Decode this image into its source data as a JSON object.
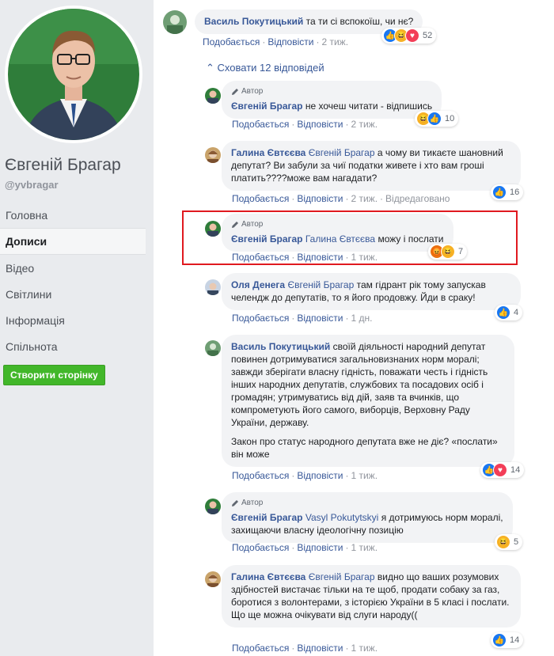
{
  "profile": {
    "name": "Євгеній Брагар",
    "handle": "@yvbragar"
  },
  "nav": {
    "items": [
      "Головна",
      "Дописи",
      "Відео",
      "Світлини",
      "Інформація",
      "Спільнота"
    ],
    "active": "Дописи",
    "create_page": "Створити сторінку"
  },
  "labels": {
    "like": "Подобається",
    "reply": "Відповісти",
    "edited": "Відредаговано",
    "author_badge": "Автор",
    "hide_replies": "Сховати 12 відповідей"
  },
  "comments": [
    {
      "author": "Василь Покутицький",
      "text": "та ти сі вспокоїш, чи нє?",
      "time": "2 тиж.",
      "reactions": [
        "like",
        "haha",
        "love"
      ],
      "count": "52"
    },
    {
      "author": "Євгеній Брагар",
      "text": "не хочеш читати - відпишись",
      "time": "2 тиж.",
      "reactions": [
        "haha",
        "like"
      ],
      "count": "10"
    },
    {
      "author": "Галина Євтєєва",
      "mention": "Євгеній Брагар",
      "text": "а чому ви тикаєте шановний депутат? Ви забули за чиї податки живете і хто вам гроші платить????може вам нагадати?",
      "time": "2 тиж.",
      "reactions": [
        "like"
      ],
      "count": "16"
    },
    {
      "author": "Євгеній Брагар",
      "mention": "Галина Євтєєва",
      "text": "можу і послати",
      "time": "1 тиж.",
      "reactions": [
        "angry",
        "haha"
      ],
      "count": "7"
    },
    {
      "author": "Оля Денега",
      "mention": "Євгеній Брагар",
      "text": "там гідрант рік тому запускав челендж до депутатів, то я його продовжу. Йди в сраку!",
      "time": "1 дн.",
      "reactions": [
        "like"
      ],
      "count": "4"
    },
    {
      "author": "Василь Покутицький",
      "text": "своїй діяльності народний депутат повинен дотримуватися загальновизнаних норм моралі; завжди зберігати власну гідність, поважати честь і гідність інших народних депутатів, службових та посадових осіб і громадян; утримуватись від дій, заяв та вчинків, що компрометують його самого, виборців, Верховну Раду України, державу.",
      "text2": "Закон про статус народного депутата вже не діє? «послати» він може",
      "time": "1 тиж.",
      "reactions": [
        "like",
        "love"
      ],
      "count": "14"
    },
    {
      "author": "Євгеній Брагар",
      "mention": "Vasyl Pokutytskyi",
      "text": "я дотримуюсь норм моралі, захищаючи власну ідеологічну позицію",
      "time": "1 тиж.",
      "reactions": [
        "haha"
      ],
      "count": "5"
    },
    {
      "author": "Галина Євтєєва",
      "mention": "Євгеній Брагар",
      "text": "видно що ваших розумових здібностей вистачає тільки на те щоб, продати собаку за газ, боротися з волонтерами, з історією України в 5 класі і послати. Що ще можна очікувати від слуги народу((",
      "time": "1 тиж.",
      "reactions": [
        "like"
      ],
      "count": "14"
    }
  ]
}
